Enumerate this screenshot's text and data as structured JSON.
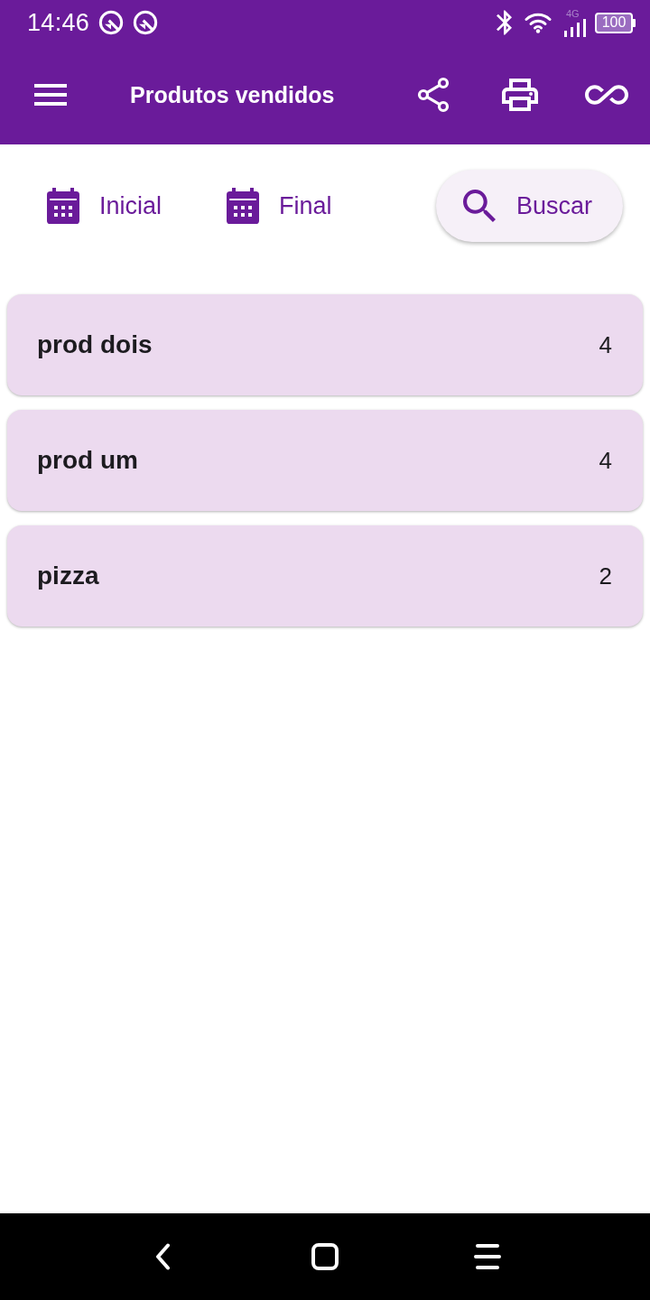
{
  "status_bar": {
    "time": "14:46",
    "network_type": "4G",
    "battery": "100"
  },
  "app_bar": {
    "title": "Produtos vendidos"
  },
  "filters": [
    {
      "kind": "date",
      "label": "Inicial"
    },
    {
      "kind": "date",
      "label": "Final"
    },
    {
      "kind": "search",
      "label": "Buscar"
    }
  ],
  "products": [
    {
      "name": "prod dois",
      "quantity": "4"
    },
    {
      "name": "prod um",
      "quantity": "4"
    },
    {
      "name": "pizza",
      "quantity": "2"
    }
  ]
}
